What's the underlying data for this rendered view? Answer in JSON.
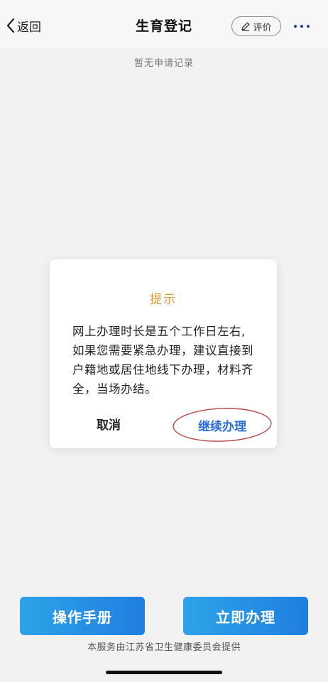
{
  "nav": {
    "back_label": "返回",
    "title": "生育登记",
    "rate_label": "评价"
  },
  "empty_note": "暂无申请记录",
  "dialog": {
    "title": "提示",
    "body": "网上办理时长是五个工作日左右,如果您需要紧急办理，建议直接到户籍地或居住地线下办理，材料齐全，当场办结。",
    "cancel_label": "取消",
    "continue_label": "继续办理"
  },
  "bottom": {
    "manual_label": "操作手册",
    "apply_label": "立即办理"
  },
  "footer_note": "本服务由江苏省卫生健康委员会提供",
  "colors": {
    "page_background": "#f2f2f2",
    "dialog_title": "#d39a3f",
    "link_blue": "#2b6fd6",
    "button_gradient_start": "#2ea3e8",
    "button_gradient_end": "#1f7fe0",
    "annotation_circle": "#b94a48"
  },
  "icons": {
    "back": "chevron-left-icon",
    "rate": "pencil-icon",
    "more": "more-dots-icon"
  }
}
